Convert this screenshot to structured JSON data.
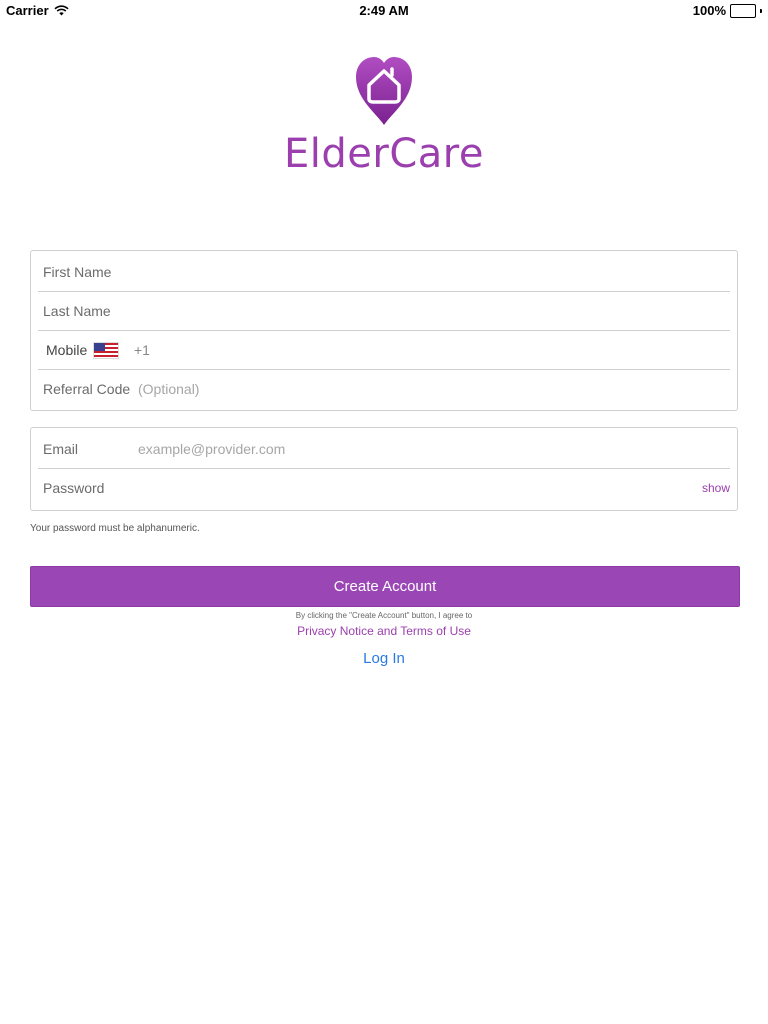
{
  "status_bar": {
    "carrier": "Carrier",
    "time": "2:49 AM",
    "battery": "100%"
  },
  "brand": {
    "name_part1": "Elder",
    "name_part2": "Care",
    "icon": "heart-house-logo",
    "color": "#9b3fae"
  },
  "form": {
    "first_name_placeholder": "First Name",
    "last_name_placeholder": "Last Name",
    "mobile_label": "Mobile",
    "mobile_flag": "us-flag-icon",
    "mobile_code": "+1",
    "referral_label": "Referral Code",
    "referral_placeholder": "(Optional)",
    "email_label": "Email",
    "email_placeholder": "example@provider.com",
    "password_label": "Password",
    "show_label": "show",
    "password_hint": "Your password must be alphanumeric."
  },
  "actions": {
    "create_account": "Create Account",
    "agreement_text": "By clicking the \"Create Account\" button, I agree to",
    "terms_link": "Privacy Notice and Terms of Use",
    "login_link": "Log In"
  },
  "colors": {
    "accent": "#9b46b5",
    "link_blue": "#2a7ae2"
  }
}
